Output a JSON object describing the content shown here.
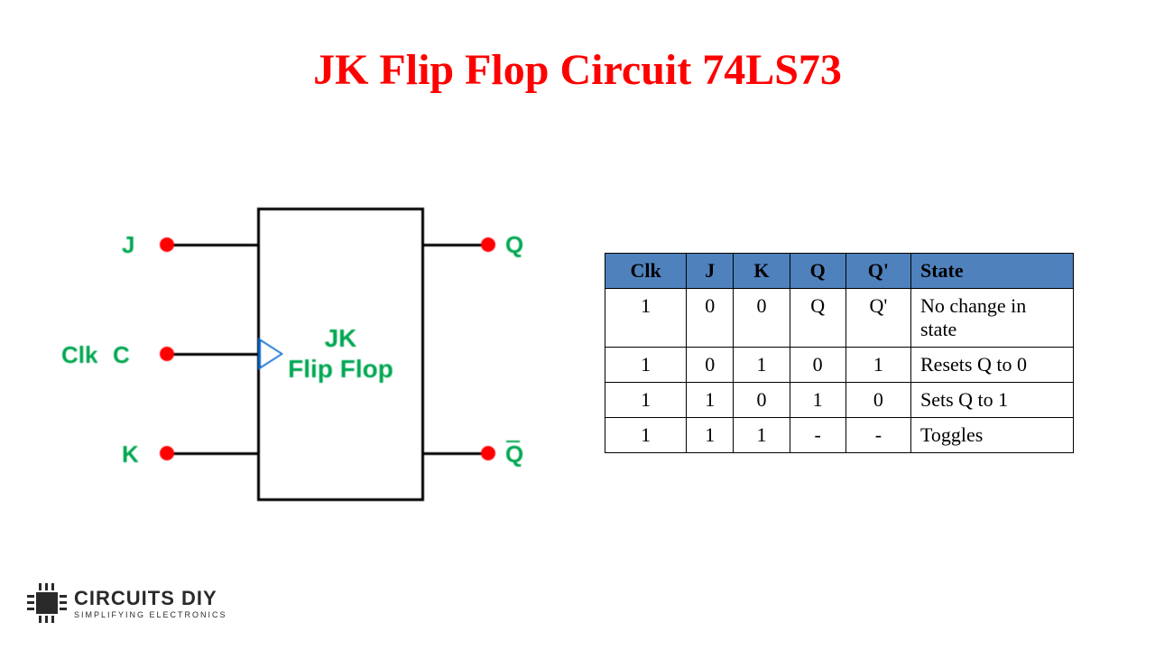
{
  "title": "JK Flip Flop Circuit 74LS73",
  "circuit": {
    "block_label_line1": "JK",
    "block_label_line2": "Flip Flop",
    "pins": {
      "J": "J",
      "Clk": "Clk",
      "C": "C",
      "K": "K",
      "Q": "Q",
      "Qbar": "Q"
    }
  },
  "chart_data": {
    "type": "table",
    "headers": [
      "Clk",
      "J",
      "K",
      "Q",
      "Q'",
      "State"
    ],
    "rows": [
      {
        "Clk": "1",
        "J": "0",
        "K": "0",
        "Q": "Q",
        "Qp": "Q'",
        "State": "No change in state"
      },
      {
        "Clk": "1",
        "J": "0",
        "K": "1",
        "Q": "0",
        "Qp": "1",
        "State": "Resets Q to 0"
      },
      {
        "Clk": "1",
        "J": "1",
        "K": "0",
        "Q": "1",
        "Qp": "0",
        "State": "Sets Q to 1"
      },
      {
        "Clk": "1",
        "J": "1",
        "K": "1",
        "Q": "-",
        "Qp": "-",
        "State": "Toggles"
      }
    ]
  },
  "logo": {
    "main": "CIRCUITS DIY",
    "sub": "SIMPLIFYING ELECTRONICS"
  }
}
